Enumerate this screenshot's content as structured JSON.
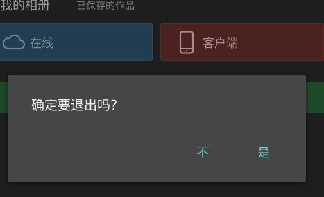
{
  "header": {
    "title": "我的相册",
    "subtitle": "已保存的作品"
  },
  "tiles": {
    "online": {
      "label": "在线",
      "icon": "cloud-icon"
    },
    "client": {
      "label": "客户端",
      "icon": "phone-icon"
    }
  },
  "dialog": {
    "message": "确定要退出吗？",
    "no_label": "不",
    "yes_label": "是"
  },
  "colors": {
    "background": "#1e1e1e",
    "dialog_background": "#464646",
    "accent": "#6fd3c8",
    "online_tile": "#203d52",
    "client_tile": "#4a2320",
    "green_tile": "#1f4a2a"
  }
}
